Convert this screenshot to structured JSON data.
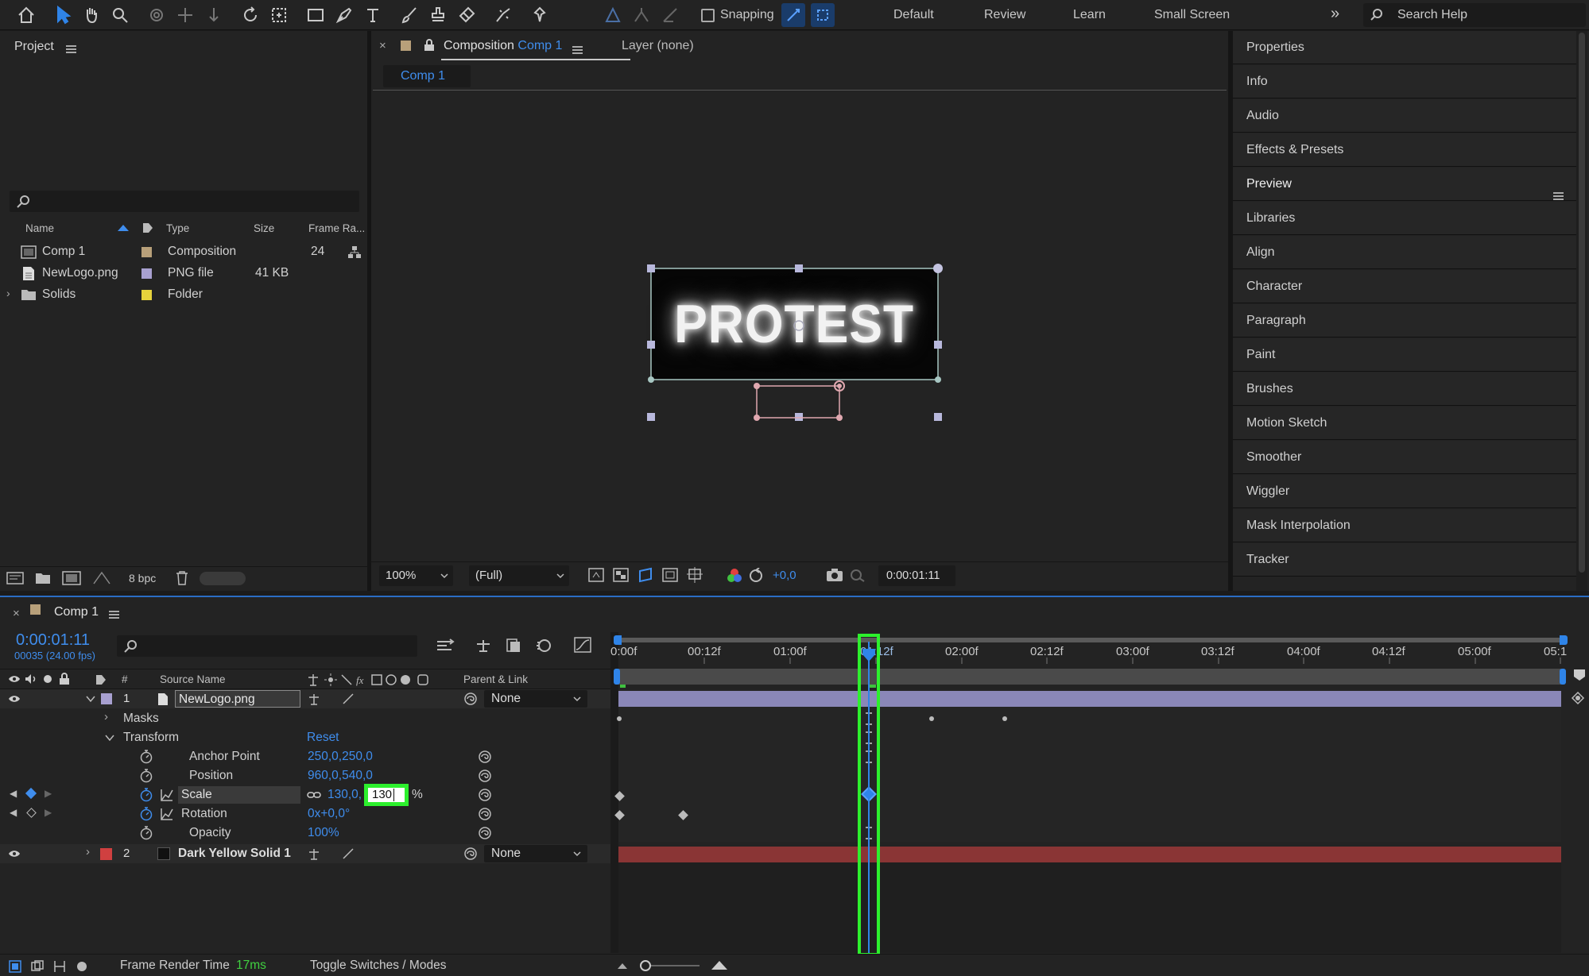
{
  "toolbar": {
    "snapping_label": "Snapping",
    "workspaces": [
      "Default",
      "Review",
      "Learn",
      "Small Screen"
    ],
    "search_placeholder": "Search Help"
  },
  "project": {
    "title": "Project",
    "columns": {
      "name": "Name",
      "type": "Type",
      "size": "Size",
      "frame_rate": "Frame Ra..."
    },
    "items": [
      {
        "name": "Comp 1",
        "type": "Composition",
        "size": "",
        "frame_rate": "24",
        "swatch": "#b8a07a"
      },
      {
        "name": "NewLogo.png",
        "type": "PNG file",
        "size": "41 KB",
        "frame_rate": "",
        "swatch": "#a8a0d0"
      },
      {
        "name": "Solids",
        "type": "Folder",
        "size": "",
        "frame_rate": "",
        "swatch": "#e6d23c"
      }
    ],
    "bpc": "8 bpc"
  },
  "viewer": {
    "tab_prefix": "Composition",
    "tab_comp": "Comp 1",
    "layer_tab": "Layer (none)",
    "breadcrumb": "Comp 1",
    "logo_text": "PROTEST",
    "zoom": "100%",
    "resolution": "(Full)",
    "exposure": "+0,0",
    "timecode": "0:00:01:11"
  },
  "right_panel": {
    "items": [
      "Properties",
      "Info",
      "Audio",
      "Effects & Presets",
      "Preview",
      "Libraries",
      "Align",
      "Character",
      "Paragraph",
      "Paint",
      "Brushes",
      "Motion Sketch",
      "Smoother",
      "Wiggler",
      "Mask Interpolation",
      "Tracker"
    ]
  },
  "timeline": {
    "tab": "Comp 1",
    "timecode": "0:00:01:11",
    "frames": "00035 (24.00 fps)",
    "headers": {
      "num": "#",
      "source": "Source Name",
      "parent": "Parent & Link"
    },
    "ruler": [
      "0:00f",
      "00:12f",
      "01:00f",
      "01:12f",
      "02:00f",
      "02:12f",
      "03:00f",
      "03:12f",
      "04:00f",
      "04:12f",
      "05:00f",
      "05:1"
    ],
    "layer1": {
      "num": "1",
      "name": "NewLogo.png",
      "parent": "None",
      "color": "#a8a0d0"
    },
    "masks": "Masks",
    "transform": "Transform",
    "reset": "Reset",
    "props": [
      {
        "name": "Anchor Point",
        "value": "250,0,250,0"
      },
      {
        "name": "Position",
        "value": "960,0,540,0"
      },
      {
        "name": "Scale",
        "value": "130,0,",
        "edit": "130",
        "unit": "%"
      },
      {
        "name": "Rotation",
        "value": "0x+0,0°"
      },
      {
        "name": "Opacity",
        "value": "100%"
      }
    ],
    "layer2": {
      "num": "2",
      "name": "Dark Yellow Solid 1",
      "parent": "None",
      "color": "#d04040"
    },
    "footer": {
      "render_label": "Frame Render Time",
      "render_value": "17ms",
      "toggle": "Toggle Switches / Modes"
    }
  },
  "colors": {
    "accent": "#2f84e8",
    "highlight": "#2df02d",
    "layer1_bar": "#8a87b8",
    "layer2_bar": "#8a3535"
  }
}
